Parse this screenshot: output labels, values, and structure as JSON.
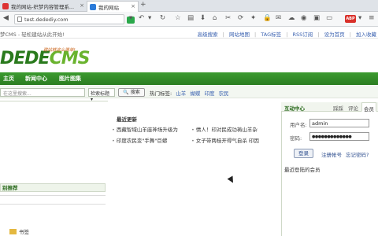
{
  "browser": {
    "tabs": [
      {
        "label": "我的网站-织梦内容管理系...",
        "active": false
      },
      {
        "label": "我的网站",
        "active": true
      }
    ],
    "new_tab": "+",
    "url": "test.dedediy.com",
    "adblock_label": "ABP"
  },
  "site": {
    "welcome": "梦CMS - 轻松建站从此开始!",
    "top_links": [
      "高级搜索",
      "网站地图",
      "TAG标签",
      "RSS订阅",
      "设为首页",
      "加入收藏"
    ],
    "logo_part1": "DEDE",
    "logo_part2": "CMS",
    "slogan": "建站就这么简单!",
    "nav": [
      "主页",
      "新闻中心",
      "图片图集"
    ],
    "search": {
      "placeholder": "在这里搜索...",
      "select_value": "检索标题",
      "button": "搜索",
      "hot_label": "热门标签:",
      "hot_tags": [
        "山羊",
        "蝴蝶",
        "印度",
        "农民"
      ]
    },
    "left": {
      "section_title": "别推荐"
    },
    "recent": {
      "title": "最近更新",
      "items": [
        "西藏智域山羊座神场升级为",
        "印度农民变\"手舞\"巨蟒",
        "情人！印对民成功祷山羊杂",
        "女子带两桂开得气自杀 印因"
      ]
    },
    "member": {
      "title": "互动中心",
      "tabs": [
        "踩踩",
        "评论",
        "会员"
      ],
      "active_tab": "会员",
      "username_label": "用户名:",
      "username_value": "admin",
      "password_label": "密码:",
      "password_value": "●●●●●●●●●●●●●",
      "login_button": "登录",
      "register_link": "注册帐号",
      "forgot_link": "忘记密码?",
      "recent_members": "最近登陆的会员"
    },
    "bottom_item": "书签"
  }
}
